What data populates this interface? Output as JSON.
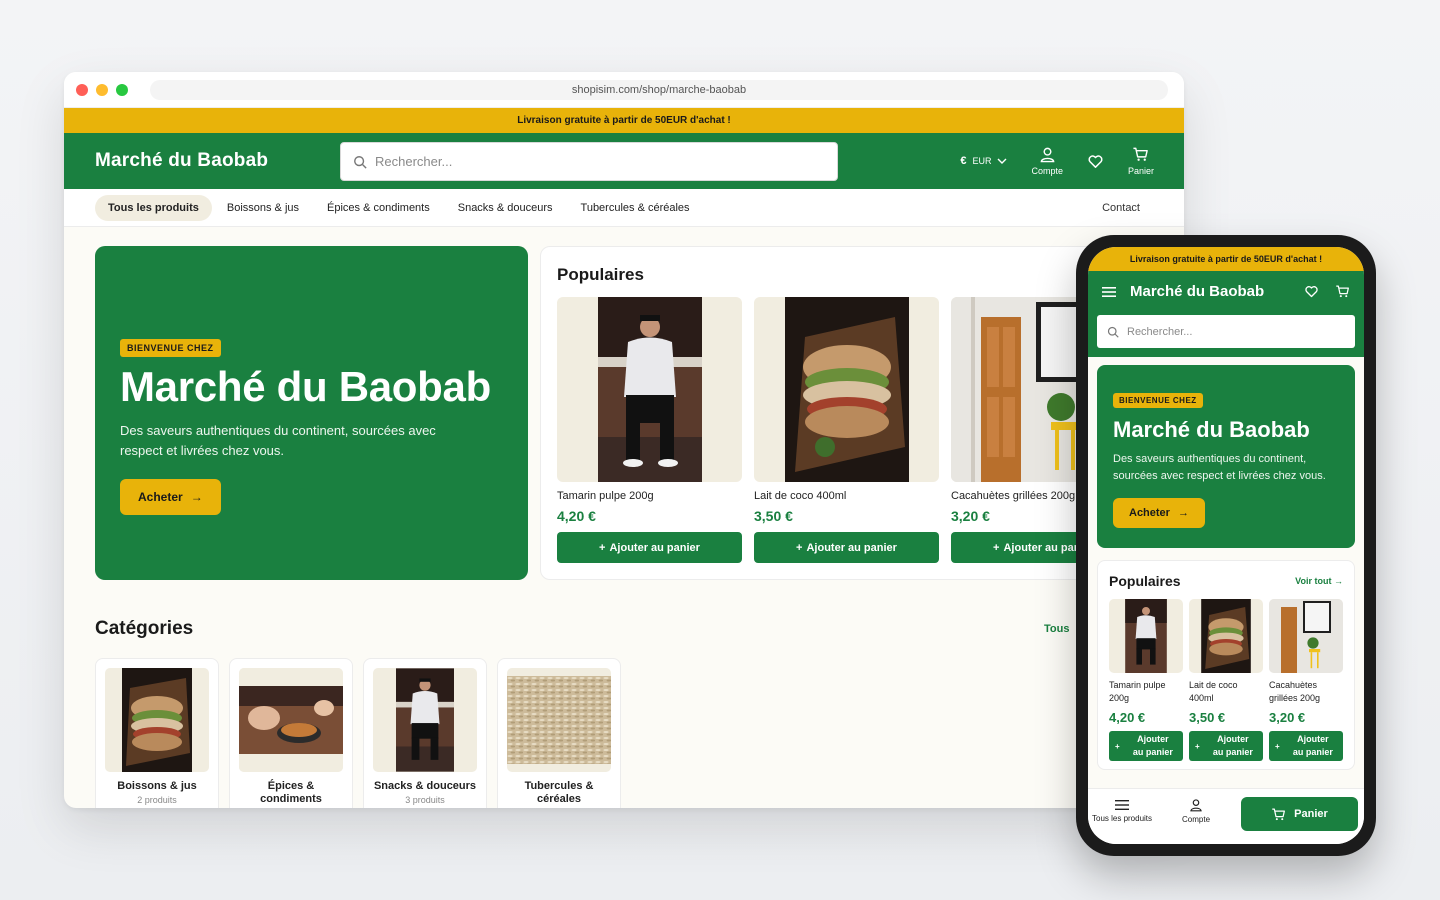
{
  "colors": {
    "brand_green": "#1a8040",
    "accent_yellow": "#e8b30a",
    "cream": "#f1ede0"
  },
  "browser": {
    "url": "shopisim.com/shop/marche-baobab"
  },
  "promo": {
    "text": "Livraison gratuite à partir de 50EUR d'achat !"
  },
  "header": {
    "logo": "Marché du Baobab",
    "search_placeholder": "Rechercher...",
    "currency_symbol": "€",
    "currency_code": "EUR",
    "account_label": "Compte",
    "cart_label": "Panier"
  },
  "nav": {
    "items": [
      {
        "label": "Tous les produits"
      },
      {
        "label": "Boissons & jus"
      },
      {
        "label": "Épices & condiments"
      },
      {
        "label": "Snacks & douceurs"
      },
      {
        "label": "Tubercules & céréales"
      }
    ],
    "contact": "Contact"
  },
  "hero": {
    "badge": "BIENVENUE CHEZ",
    "title": "Marché du Baobab",
    "subtitle": "Des saveurs authentiques du continent, sourcées avec respect et livrées chez vous.",
    "cta": "Acheter"
  },
  "popular": {
    "title": "Populaires",
    "see_all": "Voir tout →",
    "add_label": "Ajouter au panier",
    "products": [
      {
        "name": "Tamarin pulpe 200g",
        "price": "4,20 €",
        "image": "hoodie-person-photo"
      },
      {
        "name": "Lait de coco 400ml",
        "price": "3,50 €",
        "image": "sandwich-photo"
      },
      {
        "name": "Cacahuètes grillées 200g",
        "price": "3,20 €",
        "image": "door-room-photo"
      }
    ]
  },
  "categories": {
    "title": "Catégories",
    "all_label": "Tous",
    "items": [
      {
        "name": "Boissons & jus",
        "count": "2 produits",
        "image": "sandwich-photo"
      },
      {
        "name": "Épices & condiments",
        "count": "",
        "image": "cooking-photo"
      },
      {
        "name": "Snacks & douceurs",
        "count": "3 produits",
        "image": "hoodie-person-photo"
      },
      {
        "name": "Tubercules & céréales",
        "count": "",
        "image": "grain-photo"
      }
    ]
  },
  "mobile": {
    "bottom_nav": {
      "all_products": "Tous les produits",
      "account": "Compte",
      "cart": "Panier"
    },
    "add_label_line1": "Ajouter",
    "add_label_line2": "au panier"
  }
}
